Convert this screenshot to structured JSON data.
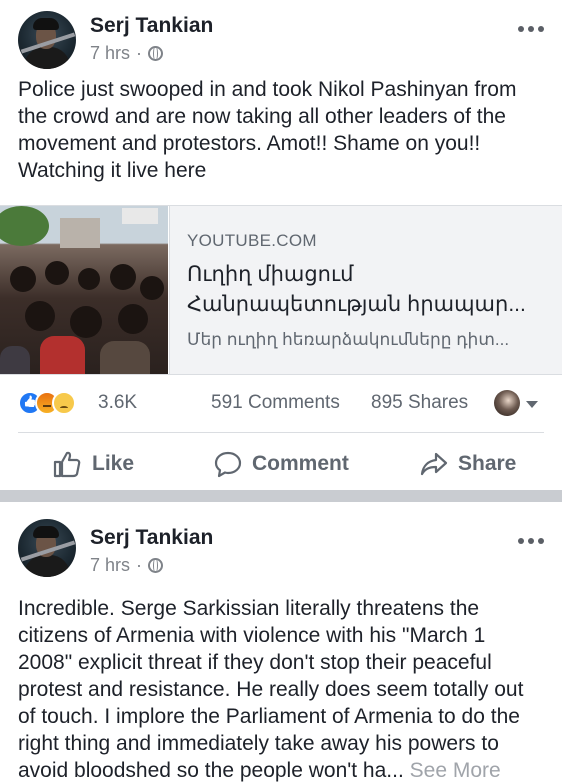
{
  "post1": {
    "author": "Serj Tankian",
    "time": "7 hrs",
    "text": "Police just swooped in and took Nikol Pashinyan from the crowd and are now taking all other leaders of the movement and protestors. Amot!! Shame on you!! Watching it live here",
    "link": {
      "domain": "YOUTUBE.COM",
      "title": "Ուղիղ միացում Հանրապետության հրապար...",
      "description": "Մեր ուղիղ հեռարձակումները դիտ..."
    },
    "reactions_count": "3.6K",
    "comments_count": "591 Comments",
    "shares_count": "895 Shares"
  },
  "actions": {
    "like": "Like",
    "comment": "Comment",
    "share": "Share"
  },
  "post2": {
    "author": "Serj Tankian",
    "time": "7 hrs",
    "text": "Incredible. Serge Sarkissian literally threatens the citizens of Armenia with violence with his \"March 1 2008\" explicit threat if they don't stop their peaceful protest and resistance. He really does seem totally out of touch. I implore the Parliament of Armenia to do the right thing and immediately take away his powers to avoid bloodshed so the people won't ha...",
    "see_more": "See More"
  },
  "colors": {
    "text": "#1d2129",
    "muted": "#606770",
    "like_blue": "#2078f4",
    "separator": "#c9ccd1"
  }
}
